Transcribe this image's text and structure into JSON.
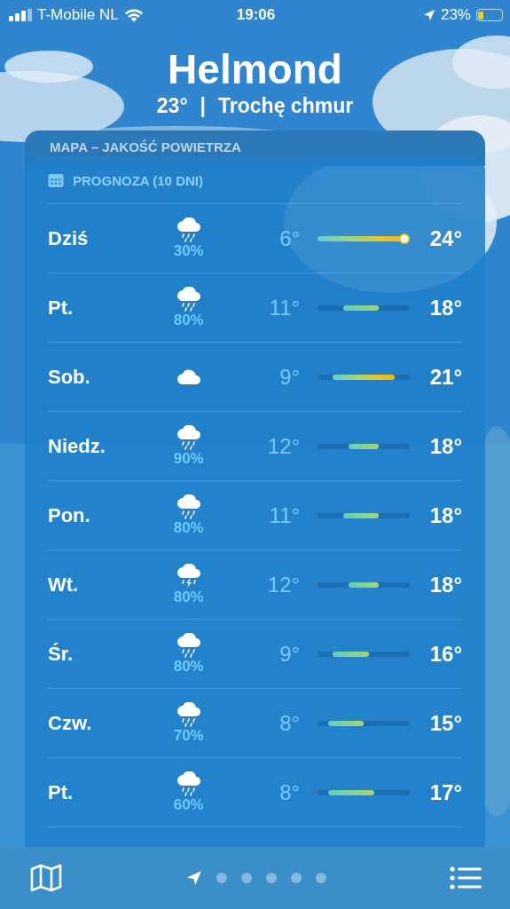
{
  "status_bar": {
    "carrier": "T-Mobile NL",
    "time": "19:06",
    "battery": "23%"
  },
  "location": {
    "city": "Helmond",
    "temperature": "23°",
    "separator": "|",
    "condition": "Trochę chmur"
  },
  "hidden_card": {
    "title": "MAPA – JAKOŚĆ POWIETRZA"
  },
  "forecast": {
    "title": "PROGNOZA (10 DNI)",
    "days": [
      {
        "day": "Dziś",
        "kind": "rain",
        "chance": "30%",
        "low": "6°",
        "high": "24°",
        "current_marker": true
      },
      {
        "day": "Pt.",
        "kind": "rain",
        "chance": "80%",
        "low": "11°",
        "high": "18°",
        "current_marker": false
      },
      {
        "day": "Sob.",
        "kind": "cloud",
        "low": "9°",
        "high": "21°",
        "current_marker": false
      },
      {
        "day": "Niedz.",
        "kind": "rain",
        "chance": "90%",
        "low": "12°",
        "high": "18°",
        "current_marker": false
      },
      {
        "day": "Pon.",
        "kind": "rain",
        "chance": "80%",
        "low": "11°",
        "high": "18°",
        "current_marker": false
      },
      {
        "day": "Wt.",
        "kind": "thunder",
        "chance": "80%",
        "low": "12°",
        "high": "18°",
        "current_marker": false
      },
      {
        "day": "Śr.",
        "kind": "rain",
        "chance": "80%",
        "low": "9°",
        "high": "16°",
        "current_marker": false
      },
      {
        "day": "Czw.",
        "kind": "rain",
        "chance": "70%",
        "low": "8°",
        "high": "15°",
        "current_marker": false
      },
      {
        "day": "Pt.",
        "kind": "rain",
        "chance": "60%",
        "low": "8°",
        "high": "17°",
        "current_marker": false
      }
    ]
  },
  "pages": [
    {
      "kind": "location",
      "selected": true
    },
    {
      "kind": "dot",
      "selected": false
    },
    {
      "kind": "dot",
      "selected": false
    },
    {
      "kind": "dot",
      "selected": false
    },
    {
      "kind": "dot",
      "selected": false
    },
    {
      "kind": "dot",
      "selected": false
    }
  ]
}
